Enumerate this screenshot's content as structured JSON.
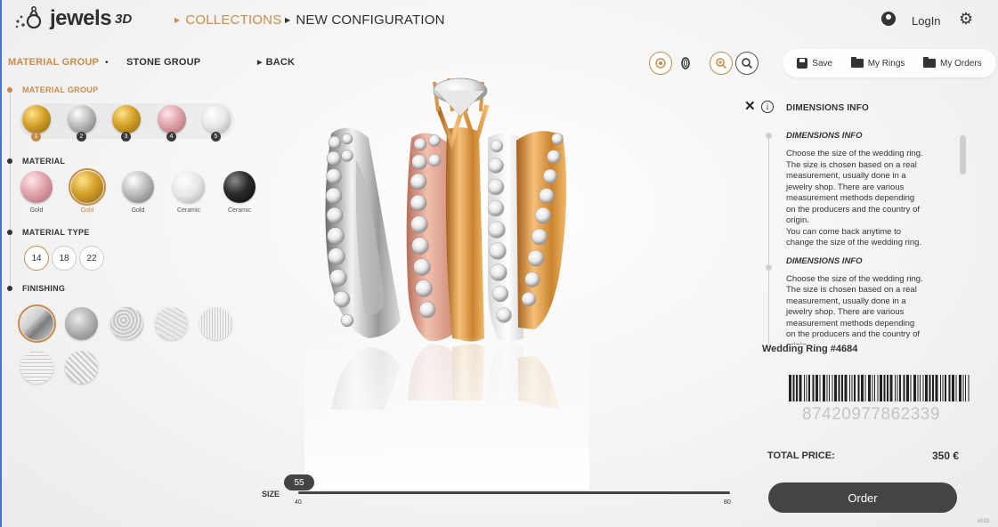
{
  "header": {
    "logo_text": "jewels",
    "logo_suffix": "3D",
    "nav": [
      {
        "label": "COLLECTIONS"
      },
      {
        "label": "NEW CONFIGURATION"
      }
    ],
    "login_label": "LogIn",
    "accent_color": "#c98b4a"
  },
  "subnav": {
    "material_group": "MATERIAL GROUP",
    "stone_group": "STONE GROUP",
    "back": "BACK"
  },
  "toolbar": {
    "save": "Save",
    "my_rings": "My Rings",
    "my_orders": "My Orders"
  },
  "left_panel": {
    "material_group": {
      "label": "MATERIAL GROUP",
      "slots": [
        "1",
        "2",
        "3",
        "4",
        "5"
      ]
    },
    "material": {
      "label": "MATERIAL",
      "options": [
        "Gold",
        "Gold",
        "Gold",
        "Ceramic",
        "Ceramic"
      ]
    },
    "material_type": {
      "label": "MATERIAL TYPE",
      "options": [
        "14",
        "18",
        "22"
      ]
    },
    "finishing": {
      "label": "FINISHING"
    }
  },
  "info_panel": {
    "header": "DIMENSIONS INFO",
    "entries": [
      {
        "title": "DIMENSIONS INFO",
        "body": "Choose the size of the wedding ring.\nThe size is chosen based on a real\nmeasurement, usually done in a\njewelry shop. There are various\nmeasurement methods depending\non the producers and the country of\norigin.\nYou can come back anytime to\nchange the size of the wedding ring."
      },
      {
        "title": "DIMENSIONS INFO",
        "body": "Choose the size of the wedding ring.\nThe size is chosen based on a real\nmeasurement, usually done in a\njewelry shop. There are various\nmeasurement methods depending\non the producers and the country of\norigin."
      }
    ]
  },
  "product": {
    "name": "Wedding Ring #4684",
    "barcode": "87420977862339",
    "total_label": "TOTAL PRICE:",
    "total_value": "350 €",
    "order_label": "Order"
  },
  "size_slider": {
    "label": "SIZE",
    "value": "55",
    "min": "40",
    "max": "80"
  },
  "version": "v033"
}
